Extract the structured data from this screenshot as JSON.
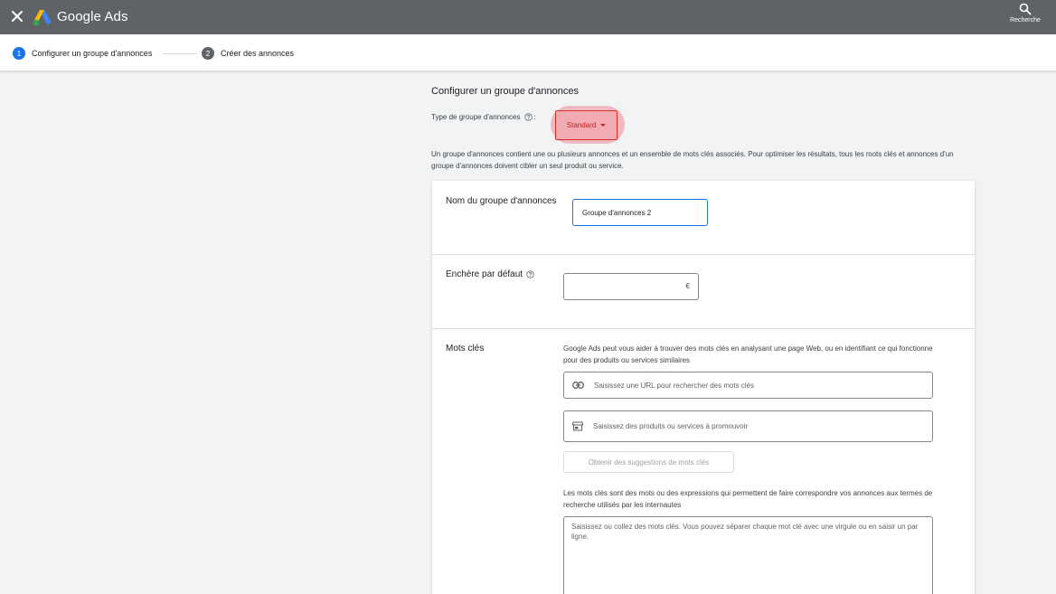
{
  "app": {
    "brand": "Google Ads",
    "search_label": "Recherche"
  },
  "steps": [
    {
      "number": "1",
      "label": "Configurer un groupe d'annonces"
    },
    {
      "number": "2",
      "label": "Créer des annonces"
    }
  ],
  "section": {
    "title": "Configurer un groupe d'annonces",
    "type_label": "Type de groupe d'annonces",
    "type_colon": ":",
    "type_value": "Standard",
    "description": "Un groupe d'annonces contient une ou plusieurs annonces et un ensemble de mots clés associés. Pour optimiser les résultats, tous les mots clés et annonces d'un groupe d'annonces doivent cibler un seul produit ou service."
  },
  "form": {
    "name_label": "Nom du groupe d'annonces",
    "name_value": "Groupe d'annonces 2",
    "bid_label": "Enchère par défaut",
    "bid_currency": "€",
    "keywords_label": "Mots clés",
    "keywords_help": "Google Ads peut vous aider à trouver des mots clés en analysant une page Web, ou en identifiant ce qui fonctionne pour des produits ou services similaires",
    "url_placeholder": "Saisissez une URL pour rechercher des mots clés",
    "products_placeholder": "Saisissez des produits ou services à promouvoir",
    "suggest_button": "Obtenir des suggestions de mots clés",
    "keywords_note": "Les mots clés sont des mots ou des expressions qui permettent de faire correspondre vos annonces aux termes de recherche utilisés par les internautes",
    "keywords_placeholder": "Saisissez ou collez des mots clés. Vous pouvez séparer chaque mot clé avec une virgule ou en saisir un par ligne."
  },
  "colors": {
    "accent": "#1a73e8",
    "topbar": "#5f6368",
    "highlight": "#f07082"
  },
  "icons": [
    "close-icon",
    "google-ads-logo",
    "search-icon",
    "help-icon",
    "link-icon",
    "store-icon",
    "caret-down-icon"
  ]
}
